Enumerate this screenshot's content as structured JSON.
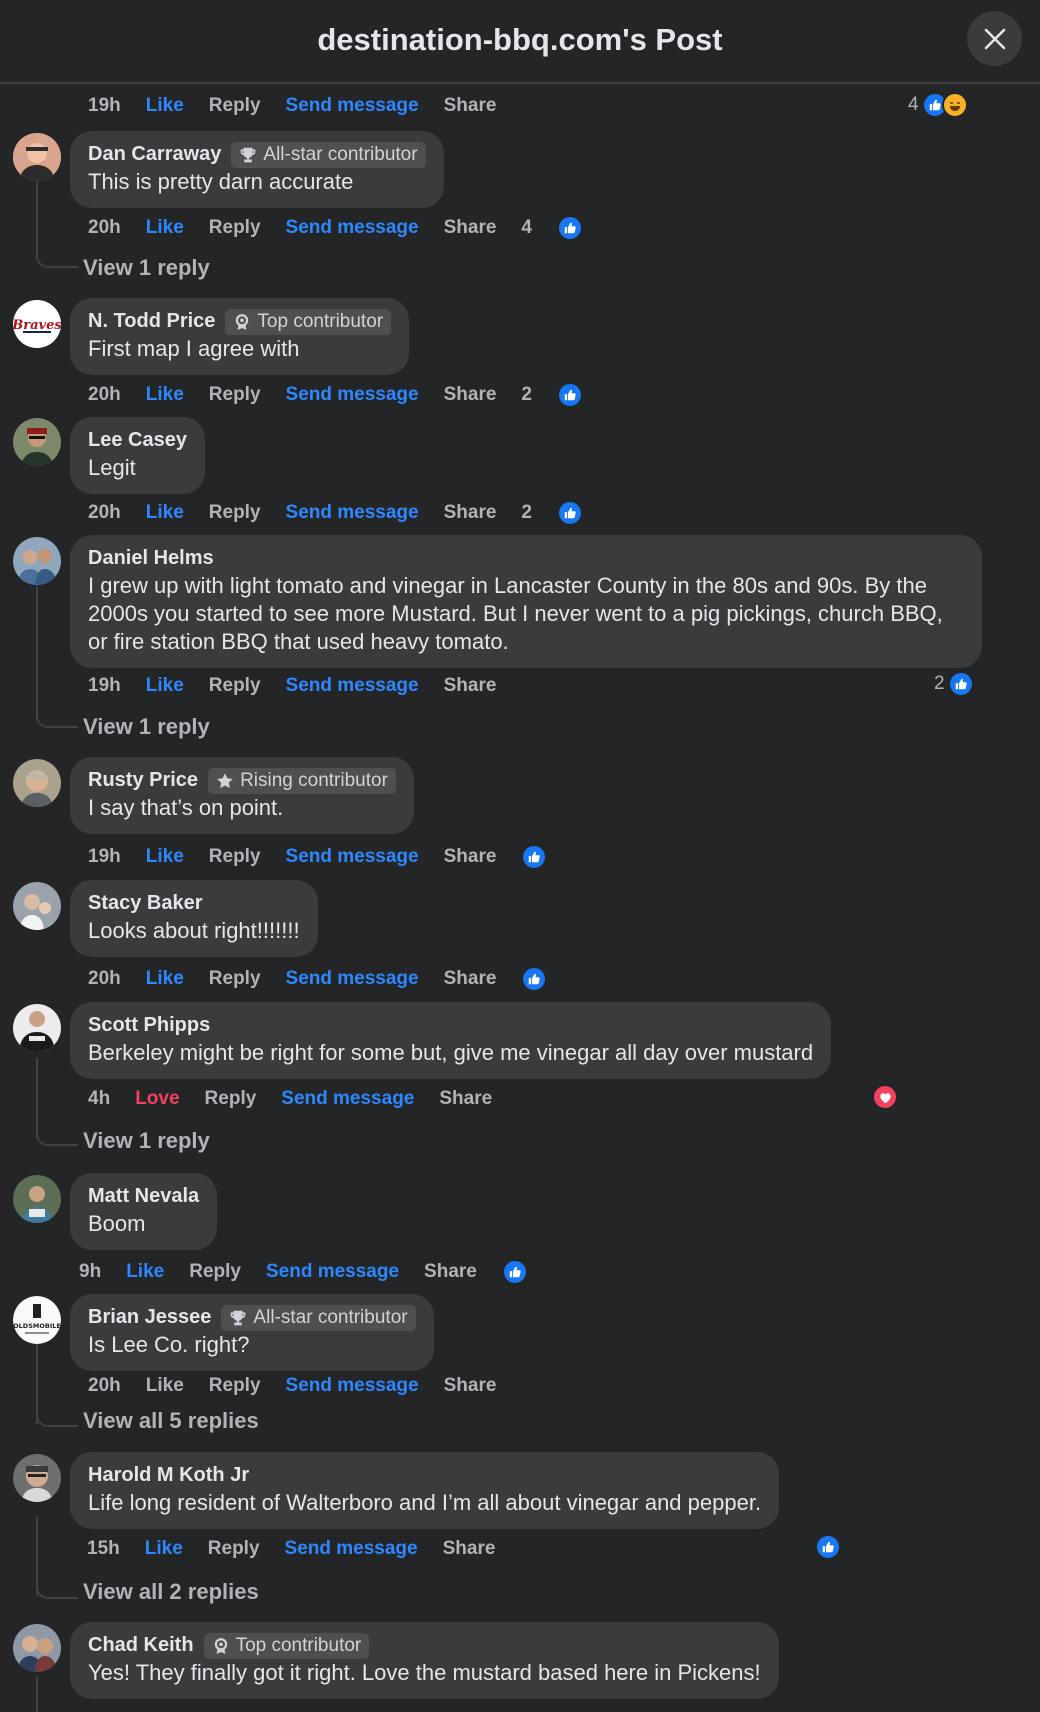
{
  "header": {
    "title": "destination-bbq.com's Post"
  },
  "actions": {
    "like": "Like",
    "love": "Love",
    "reply": "Reply",
    "send": "Send message",
    "share": "Share"
  },
  "top_row": {
    "time": "19h",
    "reaction_count": "4"
  },
  "comments": [
    {
      "name": "Dan Carraway",
      "badge": "All-star contributor",
      "badge_icon": "trophy-icon",
      "text": "This is pretty darn accurate",
      "time": "20h",
      "reaction_count": "4",
      "view_replies": "View 1 reply"
    },
    {
      "name": "N. Todd Price",
      "badge": "Top contributor",
      "badge_icon": "medal-icon",
      "text": "First map I agree with",
      "time": "20h",
      "reaction_count": "2"
    },
    {
      "name": "Lee Casey",
      "text": "Legit",
      "time": "20h",
      "reaction_count": "2"
    },
    {
      "name": "Daniel Helms",
      "text": "I grew up with light tomato and vinegar in Lancaster County in the 80s and 90s. By the 2000s you started to see more Mustard. But I never went to a pig pickings, church BBQ, or fire station BBQ that used heavy tomato.",
      "time": "19h",
      "reaction_count": "2",
      "view_replies": "View 1 reply"
    },
    {
      "name": "Rusty Price",
      "badge": "Rising contributor",
      "badge_icon": "star-icon",
      "text": "I say that’s on point.",
      "time": "19h"
    },
    {
      "name": "Stacy Baker",
      "text": "Looks about right!!!!!!!",
      "time": "20h"
    },
    {
      "name": "Scott Phipps",
      "text": "Berkeley might be right for some but, give me vinegar all day over mustard",
      "time": "4h",
      "view_replies": "View 1 reply"
    },
    {
      "name": "Matt Nevala",
      "text": "Boom",
      "time": "9h"
    },
    {
      "name": "Brian Jessee",
      "badge": "All-star contributor",
      "badge_icon": "trophy-icon",
      "text": "Is Lee Co. right?",
      "time": "20h",
      "view_replies": "View all 5 replies"
    },
    {
      "name": "Harold M Koth Jr",
      "text": "Life long resident of Walterboro and I’m all about vinegar and pepper.",
      "time": "15h",
      "view_replies": "View all 2 replies"
    },
    {
      "name": "Chad Keith",
      "badge": "Top contributor",
      "badge_icon": "medal-icon",
      "text": "Yes! They finally got it right. Love the mustard based here in Pickens!"
    }
  ],
  "colors": {
    "background": "#242526",
    "bubble": "#3a3b3c",
    "accent": "#2d88ff",
    "love": "#f3425f",
    "muted": "#b0b3b8"
  }
}
